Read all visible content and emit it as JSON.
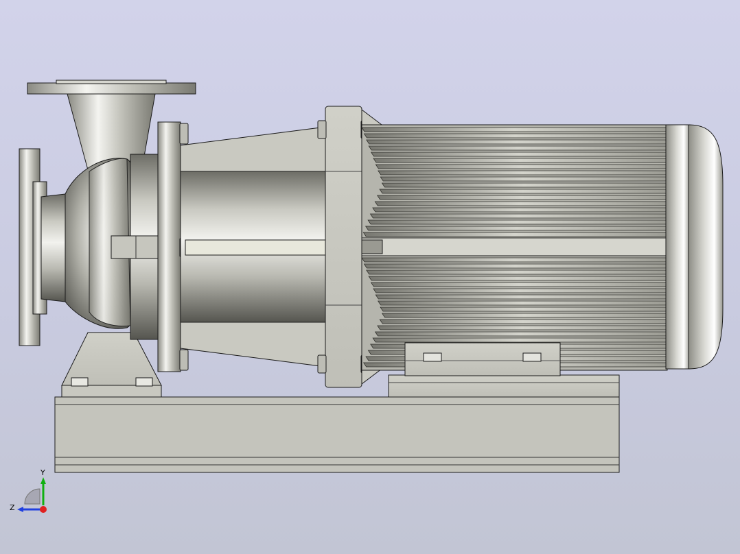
{
  "app": {
    "view": "graphics-viewport"
  },
  "model": {
    "name": "",
    "parts": [
      "suction-flange",
      "discharge-flange",
      "volute-casing",
      "bearing-bracket",
      "adapter-lantern",
      "motor-flange",
      "motor-frame",
      "cooling-fins",
      "fan-cover",
      "motor-foot",
      "pump-foot",
      "base-frame"
    ]
  },
  "triad": {
    "x_label": "",
    "y_label": "Y",
    "z_label": "Z",
    "colors": {
      "x": "#e02020",
      "y": "#10b010",
      "z": "#2040e0"
    }
  },
  "colors": {
    "background_top": "#d2d3ea",
    "background_bottom": "#c2c5d4",
    "metal_light": "#f2f2ee",
    "metal_mid": "#b8b8b0",
    "metal_dark": "#55554f",
    "outline": "#1a1a1a"
  }
}
